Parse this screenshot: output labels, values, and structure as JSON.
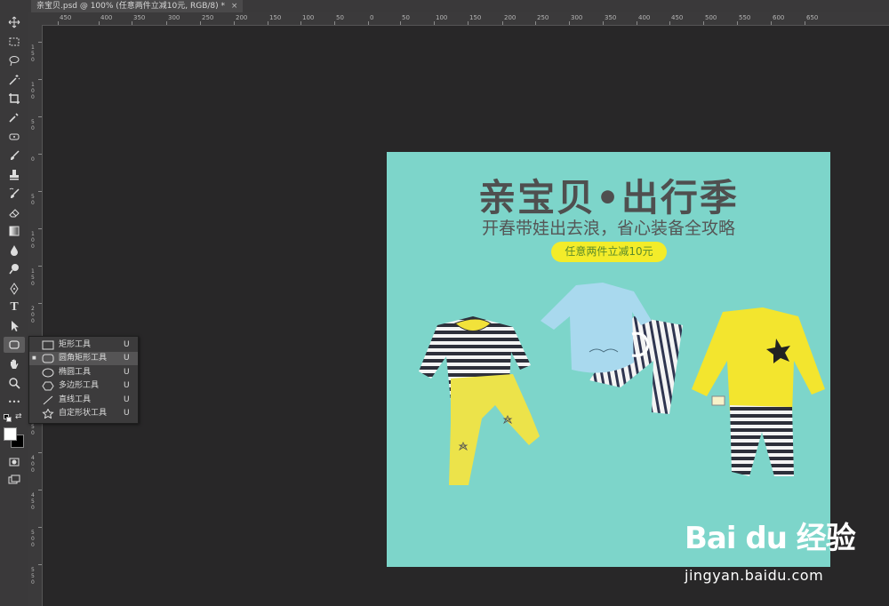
{
  "document_tab": {
    "title": "亲宝贝.psd @ 100% (任意两件立减10元, RGB/8) *",
    "close": "×"
  },
  "ruler": {
    "top_labels": [
      "450",
      "400",
      "350",
      "300",
      "250",
      "200",
      "150",
      "100",
      "50",
      "0",
      "50",
      "100",
      "150",
      "200",
      "250",
      "300",
      "350",
      "400",
      "450",
      "500",
      "550",
      "600",
      "650"
    ],
    "left_labels": [
      "150",
      "100",
      "50",
      "0",
      "50",
      "100",
      "150",
      "200",
      "250",
      "300",
      "350",
      "400",
      "450",
      "500",
      "550"
    ]
  },
  "tools": [
    {
      "name": "move-tool",
      "icon": "move-icon"
    },
    {
      "name": "marquee-tool",
      "icon": "marquee-icon"
    },
    {
      "name": "lasso-tool",
      "icon": "lasso-icon"
    },
    {
      "name": "magic-wand-tool",
      "icon": "magic-wand-icon"
    },
    {
      "name": "crop-tool",
      "icon": "crop-icon"
    },
    {
      "name": "eyedropper-tool",
      "icon": "eyedropper-icon"
    },
    {
      "name": "healing-tool",
      "icon": "healing-icon"
    },
    {
      "name": "brush-tool",
      "icon": "brush-icon"
    },
    {
      "name": "stamp-tool",
      "icon": "stamp-icon"
    },
    {
      "name": "history-brush-tool",
      "icon": "history-brush-icon"
    },
    {
      "name": "eraser-tool",
      "icon": "eraser-icon"
    },
    {
      "name": "gradient-tool",
      "icon": "gradient-icon"
    },
    {
      "name": "blur-tool",
      "icon": "blur-icon"
    },
    {
      "name": "dodge-tool",
      "icon": "dodge-icon"
    },
    {
      "name": "pen-tool",
      "icon": "pen-icon"
    },
    {
      "name": "type-tool",
      "icon": "type-icon",
      "glyph": "T"
    },
    {
      "name": "path-selection-tool",
      "icon": "path-selection-icon"
    },
    {
      "name": "shape-tool",
      "icon": "rounded-rectangle-icon"
    },
    {
      "name": "hand-tool",
      "icon": "hand-icon"
    },
    {
      "name": "zoom-tool",
      "icon": "zoom-icon"
    },
    {
      "name": "more-tools",
      "icon": "more-icon",
      "glyph": "•••"
    }
  ],
  "flyout": {
    "items": [
      {
        "label": "矩形工具",
        "key": "U",
        "icon": "rectangle-icon",
        "active": false
      },
      {
        "label": "圆角矩形工具",
        "key": "U",
        "icon": "rounded-rectangle-icon",
        "active": true
      },
      {
        "label": "椭圆工具",
        "key": "U",
        "icon": "ellipse-icon",
        "active": false
      },
      {
        "label": "多边形工具",
        "key": "U",
        "icon": "polygon-icon",
        "active": false
      },
      {
        "label": "直线工具",
        "key": "U",
        "icon": "line-icon",
        "active": false
      },
      {
        "label": "自定形状工具",
        "key": "U",
        "icon": "custom-shape-icon",
        "active": false
      }
    ],
    "bullet": "■"
  },
  "canvas": {
    "headline": "亲宝贝•出行季",
    "subline": "开春带娃出去浪，省心装备全攻略",
    "promo": "任意两件立减10元",
    "background": "#7dd5ca",
    "promo_color": "#f3ec2a"
  },
  "watermark": {
    "logo": "Bai du 经验",
    "url": "jingyan.baidu.com"
  }
}
